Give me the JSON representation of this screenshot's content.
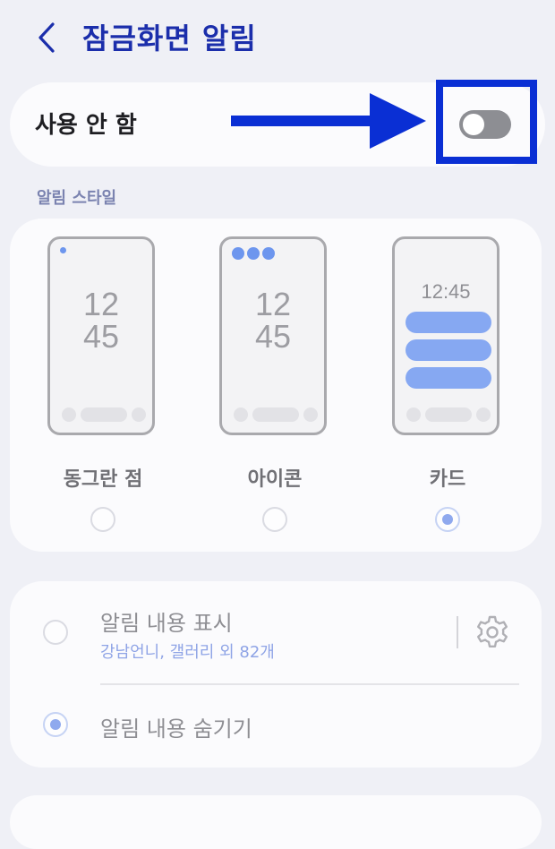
{
  "header": {
    "title": "잠금화면 알림",
    "back_icon": "chevron-left-icon"
  },
  "toggle": {
    "label": "사용 안 함",
    "state": "off"
  },
  "section": {
    "label": "알림 스타일"
  },
  "styles": [
    {
      "name": "동그란 점",
      "clock_hour": "12",
      "clock_min": "45",
      "selected": false
    },
    {
      "name": "아이콘",
      "clock_hour": "12",
      "clock_min": "45",
      "selected": false
    },
    {
      "name": "카드",
      "clock": "12:45",
      "selected": true
    }
  ],
  "content": {
    "show": {
      "label": "알림 내용 표시",
      "sub": "강남언니, 갤러리 외 82개",
      "selected": false
    },
    "hide": {
      "label": "알림 내용 숨기기",
      "selected": true
    }
  },
  "colors": {
    "title": "#1b2eab",
    "highlight": "#0a2fd4",
    "accent": "#86a8f2",
    "background": "#eff0f6"
  }
}
